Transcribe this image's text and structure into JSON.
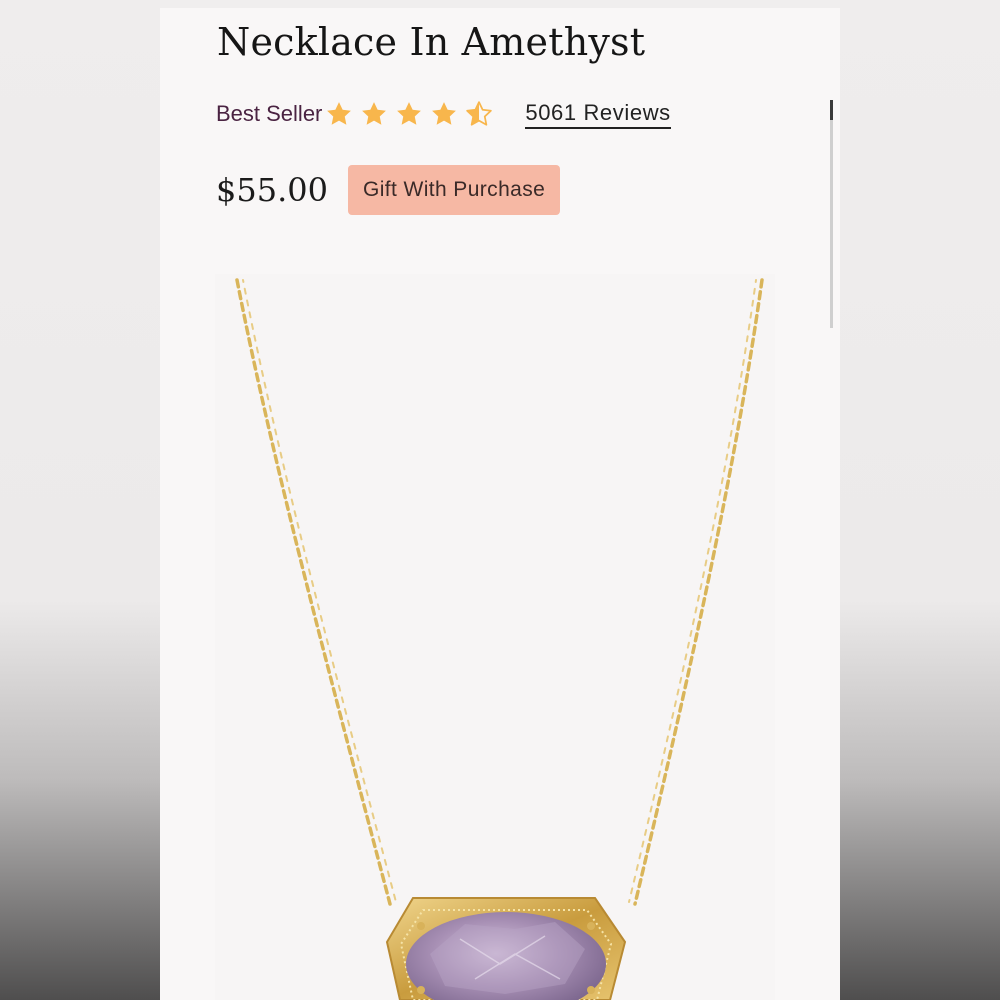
{
  "product": {
    "title": "Necklace In Amethyst",
    "badge": "Best Seller",
    "rating": 4.5,
    "rating_max": 5,
    "reviews_label": "5061 Reviews",
    "price": "$55.00",
    "promo_label": "Gift With Purchase"
  },
  "colors": {
    "badge_text": "#4a2342",
    "star": "#f8b64c",
    "promo_bg": "#f6b8a4",
    "gold_chain": "#d9b55a",
    "amethyst": "#a78fb4"
  },
  "icons": {
    "star_full": "star-icon",
    "star_half": "star-half-icon"
  }
}
